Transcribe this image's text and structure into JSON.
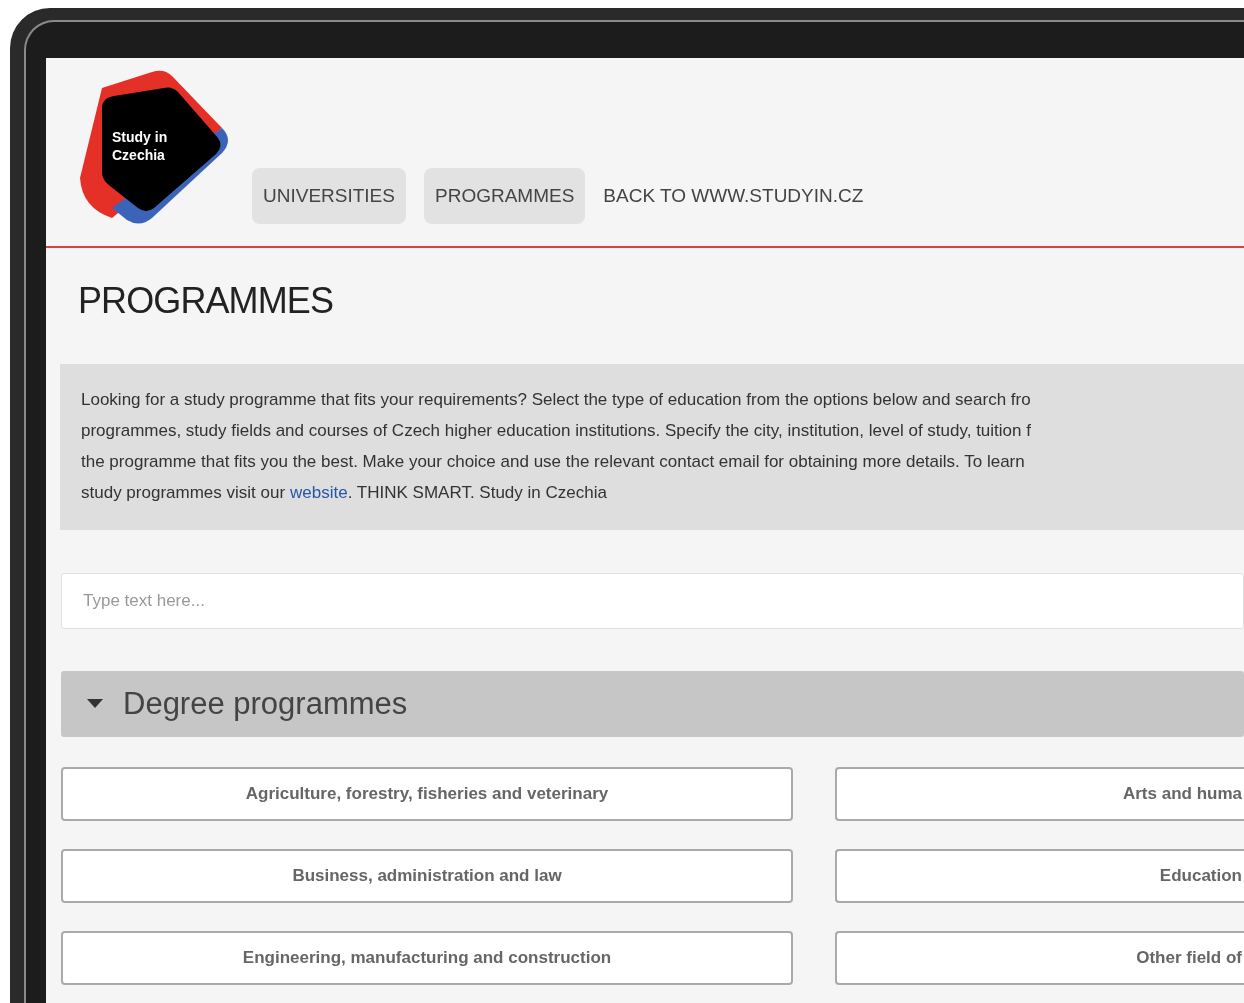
{
  "logo": {
    "lines": [
      "Study in",
      "Czechia"
    ]
  },
  "nav": [
    {
      "label": "UNIVERSITIES",
      "selected": true
    },
    {
      "label": "PROGRAMMES",
      "selected": true
    },
    {
      "label": "BACK TO WWW.STUDYIN.CZ",
      "selected": false
    }
  ],
  "page_title": "PROGRAMMES",
  "intro": {
    "lines": [
      "Looking for a study programme that fits your requirements? Select the type of education from the options below and search fro",
      "programmes, study fields and courses of Czech higher education institutions. Specify the city, institution, level of study, tuition f",
      "the programme that fits you the best. Make your choice and use the relevant contact email for obtaining more details. To learn"
    ],
    "last_line_before": "study programmes visit our",
    "link": "website",
    "last_line_after": ". THINK SMART. Study in Czechia"
  },
  "search": {
    "placeholder": "Type text here..."
  },
  "section": {
    "title": "Degree programmes",
    "expanded": true
  },
  "fields": [
    "Agriculture, forestry, fisheries and veterinary",
    "Arts and huma",
    "Business, administration and law",
    "Education",
    "Engineering, manufacturing and construction",
    "Other field of"
  ]
}
